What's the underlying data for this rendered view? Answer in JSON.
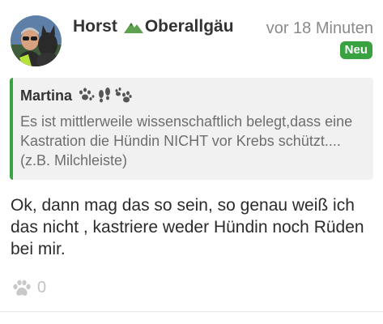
{
  "post": {
    "author_name": "Horst",
    "author_region": "Oberallgäu",
    "timestamp": "vor 18 Minuten",
    "new_badge": "Neu",
    "quote": {
      "author": "Martina",
      "text": "Es ist mittlerweile wissenschaftlich belegt,dass eine Kastration die Hündin NICHT vor Krebs schützt....(z.B. Milchleiste)"
    },
    "body": "Ok, dann mag das so sein, so genau weiß ich das nicht , kastriere weder Hündin noch Rüden bei mir.",
    "reaction_count": "0"
  },
  "icons": {
    "region": "mountain-icon",
    "quote_decor": [
      "paw-print-icon",
      "footprints-icon",
      "paw-print-icon"
    ],
    "reaction": "paw-icon"
  },
  "colors": {
    "accent_green": "#3aa341",
    "quote_background": "#f1f1f1",
    "muted_text": "#8a8a8a"
  }
}
